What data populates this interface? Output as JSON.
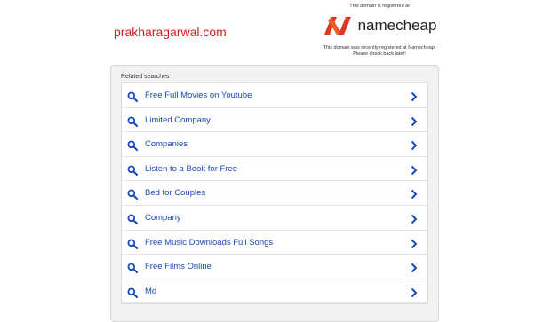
{
  "header": {
    "domain": "prakharagarwal.com"
  },
  "registrar": {
    "registered_text": "This domain is registered at",
    "brand": "namecheap",
    "recent_text": "This domain was recently registered at Namecheap.",
    "check_text": "Please check back later!",
    "brand_color": "#de3723",
    "logo_icon": "namecheap-logo-icon"
  },
  "related": {
    "title": "Related searches",
    "items": [
      "Free Full Movies on Youtube",
      "Limited Company",
      "Companies",
      "Listen to a Book for Free",
      "Bed for Couples",
      "Company",
      "Free Music Downloads Full Songs",
      "Free Films Online",
      "Md"
    ],
    "link_color": "#1a47b8",
    "icons": {
      "search": "search-icon",
      "chevron": "chevron-right-icon"
    }
  }
}
